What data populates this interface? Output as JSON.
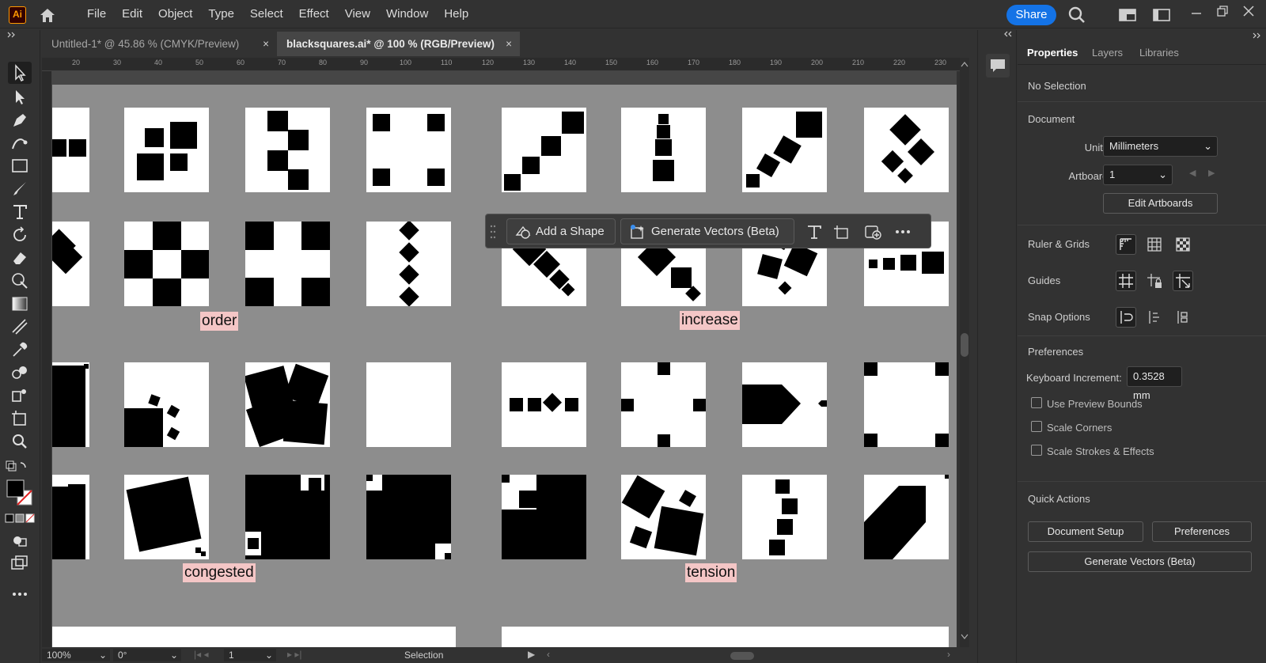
{
  "app": {
    "logo_text": "Ai",
    "share_label": "Share"
  },
  "menu": [
    "File",
    "Edit",
    "Object",
    "Type",
    "Select",
    "Effect",
    "View",
    "Window",
    "Help"
  ],
  "tabs": [
    {
      "label": "Untitled-1* @ 45.86 % (CMYK/Preview)",
      "close": "×"
    },
    {
      "label": "blacksquares.ai* @ 100 % (RGB/Preview)",
      "close": "×"
    }
  ],
  "ruler_ticks": [
    "20",
    "30",
    "40",
    "50",
    "60",
    "70",
    "80",
    "90",
    "100",
    "110",
    "120",
    "130",
    "140",
    "150",
    "160",
    "170",
    "180",
    "190",
    "200",
    "210",
    "220",
    "230"
  ],
  "canvas_labels": {
    "order": "order",
    "increase": "increase",
    "congested": "congested",
    "tension": "tension"
  },
  "floating_bar": {
    "add_shape": "Add a Shape",
    "generate": "Generate Vectors (Beta)"
  },
  "status": {
    "zoom": "100%",
    "rotation": "0°",
    "artboard": "1",
    "tool": "Selection"
  },
  "properties": {
    "tabs": [
      "Properties",
      "Layers",
      "Libraries"
    ],
    "no_selection": "No Selection",
    "document_title": "Document",
    "units_label": "Units:",
    "units_value": "Millimeters",
    "artboard_label": "Artboard:",
    "artboard_value": "1",
    "edit_artboards": "Edit Artboards",
    "ruler_grids": "Ruler & Grids",
    "guides": "Guides",
    "snap_options": "Snap Options",
    "preferences_title": "Preferences",
    "keyboard_increment_label": "Keyboard Increment:",
    "keyboard_increment_value": "0.3528 mm",
    "checkboxes": [
      "Use Preview Bounds",
      "Scale Corners",
      "Scale Strokes & Effects"
    ],
    "quick_actions": "Quick Actions",
    "document_setup": "Document Setup",
    "preferences_btn": "Preferences",
    "generate_vectors": "Generate Vectors (Beta)"
  },
  "colors": {
    "accent": "#1473e6",
    "label_bg": "#f4c6c6",
    "canvas": "#8d8d8d"
  }
}
